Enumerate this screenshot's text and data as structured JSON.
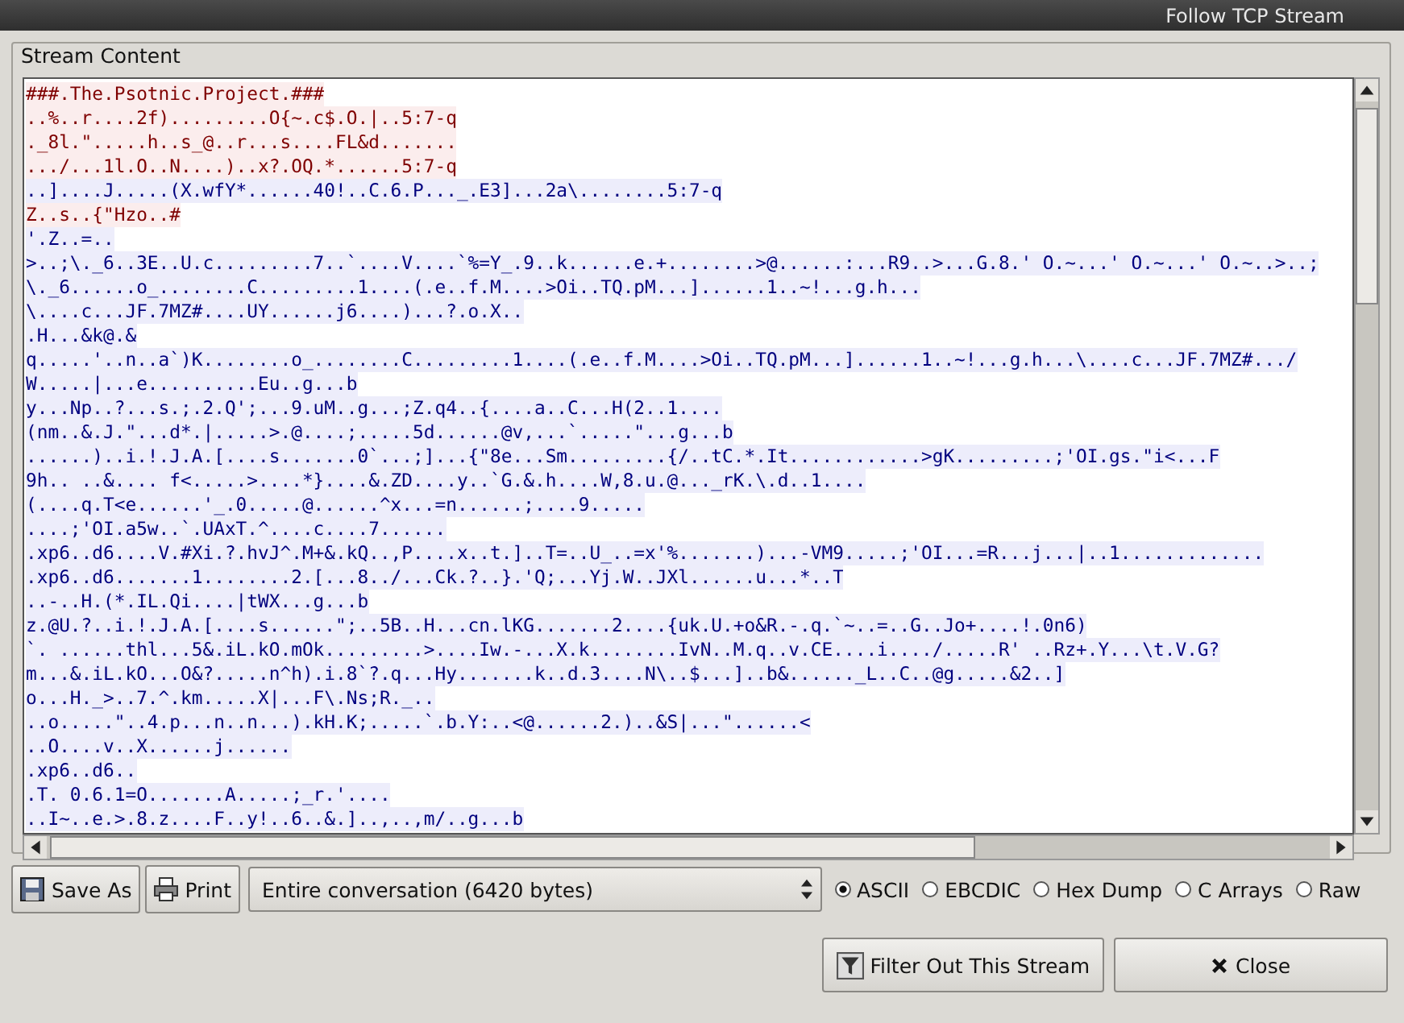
{
  "window": {
    "title": "Follow TCP Stream"
  },
  "stream_content": {
    "label": "Stream Content",
    "lines": [
      {
        "kind": "client",
        "text": "###.The.Psotnic.Project.###"
      },
      {
        "kind": "client",
        "text": "..%..r....2f).........O{~.c$.O.|..5:7-q"
      },
      {
        "kind": "client",
        "text": "._8l.\".....h..s_@..r...s....FL&d......."
      },
      {
        "kind": "client",
        "text": ".../...1l.O..N....)..x?.OQ.*......5:7-q"
      },
      {
        "kind": "server",
        "text": "..]....J.....(X.wfY*......40!..C.6.P..._.E3]...2a\\........5:7-q"
      },
      {
        "kind": "client",
        "text": "Z..s..{\"Hzo..#"
      },
      {
        "kind": "server",
        "text": "'.Z..=.."
      },
      {
        "kind": "server",
        "text": ">..;\\._6..3E..U.c.........7..`....V....`%=Y_.9..k......e.+........>@......:...R9..>...G.8.' O.~...' O.~...' O.~..>..;"
      },
      {
        "kind": "server",
        "text": "\\._6......o_........C.........1....(.e..f.M....>Oi..TQ.pM...]......1..~!...g.h..."
      },
      {
        "kind": "server",
        "text": "\\....c...JF.7MZ#....UY......j6....)...?.o.X.."
      },
      {
        "kind": "server",
        "text": ".H...&k@.&"
      },
      {
        "kind": "server",
        "text": "q.....'..n..a`)K........o_........C.........1....(.e..f.M....>Oi..TQ.pM...]......1..~!...g.h...\\....c...JF.7MZ#.../"
      },
      {
        "kind": "server",
        "text": "W.....|...e..........Eu..g...b"
      },
      {
        "kind": "server",
        "text": "y...Np..?...s.;.2.Q';...9.uM..g...;Z.q4..{....a..C...H(2..1...."
      },
      {
        "kind": "server",
        "text": "(nm..&.J.\"...d*.|.....>.@....;.....5d......@v,...`.....\"...g...b"
      },
      {
        "kind": "server",
        "text": "......)..i.!.J.A.[....s.......0`...;]...{\"8e...Sm.........{/..tC.*.It............>gK.........;'OI.gs.\"i<...F"
      },
      {
        "kind": "server",
        "text": "9h.. ..&.... f<.....>....*}....&.ZD....y..`G.&.h....W,8.u.@..._rK.\\.d..1...."
      },
      {
        "kind": "server",
        "text": "(....q.T<e......'_.0.....@......^x...=n......;....9....."
      },
      {
        "kind": "server",
        "text": "....;'OI.a5w..`.UAxT.^....c....7......"
      },
      {
        "kind": "server",
        "text": ".xp6..d6....V.#Xi.?.hvJ^.M+&.kQ..,P....x..t.]..T=..U_..=x'%.......)...-VM9.....;'OI...=R...j...|..1............."
      },
      {
        "kind": "server",
        "text": ".xp6..d6.......1........2.[...8../...Ck.?..}.'Q;...Yj.W..JXl......u...*..T"
      },
      {
        "kind": "server",
        "text": "..-..H.(*.IL.Qi....|tWX...g...b"
      },
      {
        "kind": "server",
        "text": "z.@U.?..i.!.J.A.[....s......\";..5B..H...cn.lKG.......2....{uk.U.+o&R.-.q.`~..=..G..Jo+....!.0n6)"
      },
      {
        "kind": "server",
        "text": "`. ......thl...5&.iL.kO.mOk.........>....Iw.-...X.k........IvN..M.q..v.CE....i..../.....R' ..Rz+.Y...\\t.V.G?"
      },
      {
        "kind": "server",
        "text": "m...&.iL.kO...O&?.....n^h).i.8`?.q...Hy.......k..d.3....N\\..$...]..b&......_L..C..@g.....&2..]"
      },
      {
        "kind": "server",
        "text": "o...H._>..7.^.km.....X|...F\\.Ns;R._.."
      },
      {
        "kind": "server",
        "text": "..o.....\"..4.p...n..n...).kH.K;.....`.b.Y:..<@......2.)..&S|...\"......<"
      },
      {
        "kind": "server",
        "text": "..O....v..X......j......"
      },
      {
        "kind": "server",
        "text": ".xp6..d6.."
      },
      {
        "kind": "server",
        "text": ".T. 0.6.1=O.......A.....;_r.'...."
      },
      {
        "kind": "server",
        "text": "..I~..e.>.8.z....F..y!..6..&.]..,..,m/..g...b"
      }
    ]
  },
  "toolbar": {
    "save_as": "Save As",
    "print": "Print",
    "conversation": "Entire conversation (6420 bytes)",
    "formats": [
      {
        "label": "ASCII",
        "selected": true
      },
      {
        "label": "EBCDIC",
        "selected": false
      },
      {
        "label": "Hex Dump",
        "selected": false
      },
      {
        "label": "C Arrays",
        "selected": false
      },
      {
        "label": "Raw",
        "selected": false
      }
    ]
  },
  "buttons": {
    "filter": "Filter Out This Stream",
    "close": "Close"
  }
}
